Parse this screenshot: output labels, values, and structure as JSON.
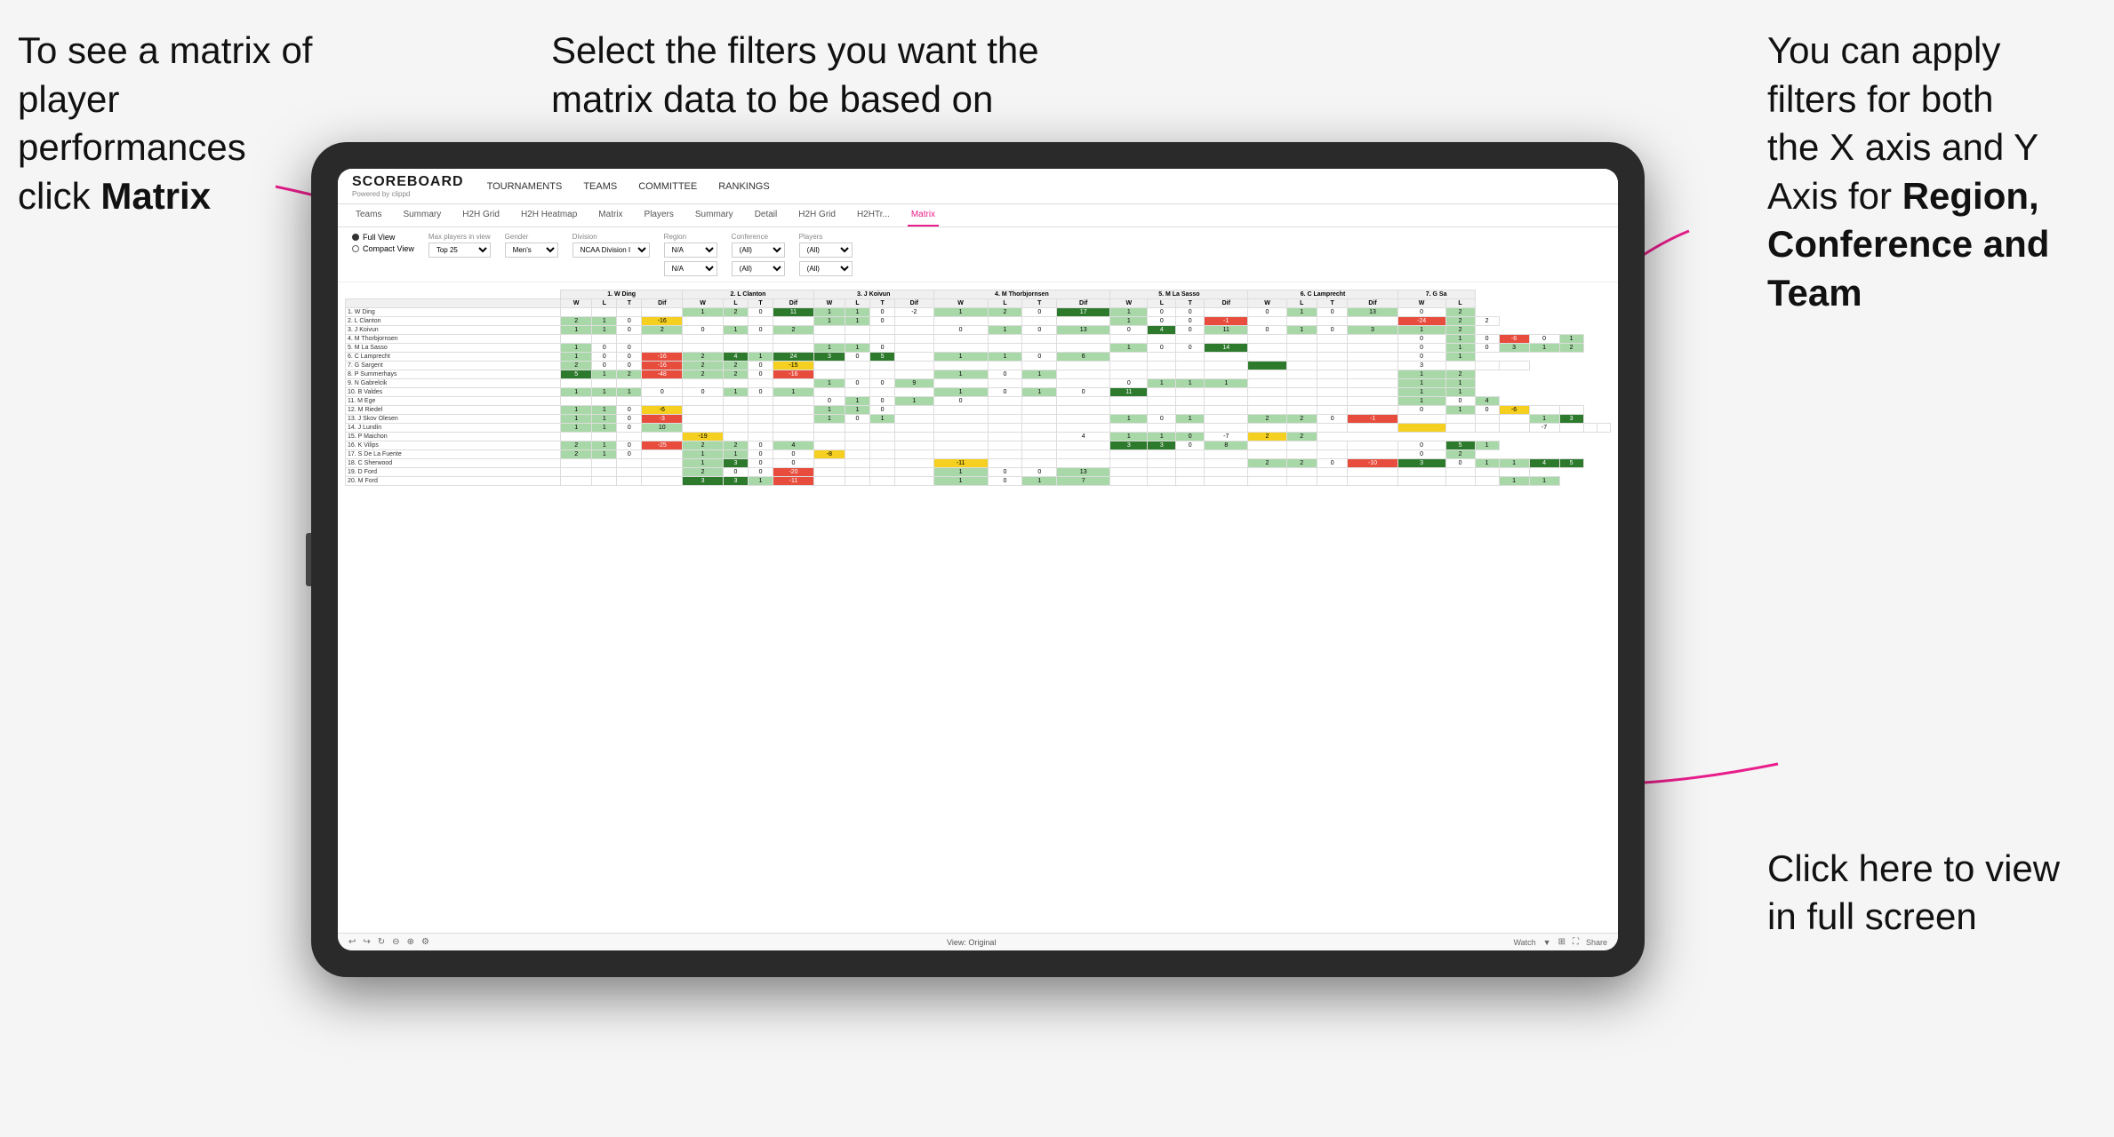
{
  "annotations": {
    "top_left": {
      "line1": "To see a matrix of",
      "line2": "player performances",
      "line3_normal": "click ",
      "line3_bold": "Matrix"
    },
    "top_center": {
      "line1": "Select the filters you want the",
      "line2": "matrix data to be based on"
    },
    "top_right": {
      "line1": "You  can apply",
      "line2": "filters for both",
      "line3": "the X axis and Y",
      "line4_normal": "Axis for ",
      "line4_bold": "Region,",
      "line5_bold": "Conference and",
      "line6_bold": "Team"
    },
    "bottom_right": {
      "line1": "Click here to view",
      "line2": "in full screen"
    }
  },
  "app": {
    "logo": "SCOREBOARD",
    "logo_sub": "Powered by clippd",
    "nav": [
      "TOURNAMENTS",
      "TEAMS",
      "COMMITTEE",
      "RANKINGS"
    ],
    "sub_nav": [
      "Teams",
      "Summary",
      "H2H Grid",
      "H2H Heatmap",
      "Matrix",
      "Players",
      "Summary",
      "Detail",
      "H2H Grid",
      "H2HTr...",
      "Matrix"
    ],
    "active_sub_nav": "Matrix"
  },
  "filters": {
    "view_full": "Full View",
    "view_compact": "Compact View",
    "max_players_label": "Max players in view",
    "max_players_value": "Top 25",
    "gender_label": "Gender",
    "gender_value": "Men's",
    "division_label": "Division",
    "division_value": "NCAA Division I",
    "region_label": "Region",
    "region_value": "N/A",
    "conference_label": "Conference",
    "conference_value": "(All)",
    "players_label": "Players",
    "players_value": "(All)"
  },
  "matrix": {
    "col_headers": [
      "1. W Ding",
      "2. L Clanton",
      "3. J Koivun",
      "4. M Thorbjornsen",
      "5. M La Sasso",
      "6. C Lamprecht",
      "7. G Sa"
    ],
    "sub_headers": [
      "W",
      "L",
      "T",
      "Dif"
    ],
    "rows": [
      {
        "name": "1. W Ding",
        "cells": [
          "",
          "",
          "",
          "",
          "1",
          "2",
          "0",
          "11",
          "1",
          "1",
          "0",
          "-2",
          "1",
          "2",
          "0",
          "17",
          "1",
          "0",
          "0",
          "",
          "0",
          "1",
          "0",
          "13",
          "0",
          "2"
        ]
      },
      {
        "name": "2. L Clanton",
        "cells": [
          "2",
          "1",
          "0",
          "-16",
          "",
          "",
          "",
          "",
          "1",
          "1",
          "0",
          "",
          "",
          "",
          "",
          "",
          "1",
          "0",
          "0",
          "-1",
          "",
          "",
          "",
          "",
          "-24",
          "2",
          "2"
        ]
      },
      {
        "name": "3. J Koivun",
        "cells": [
          "1",
          "1",
          "0",
          "2",
          "0",
          "1",
          "0",
          "2",
          "",
          "",
          "",
          "",
          "0",
          "1",
          "0",
          "13",
          "0",
          "4",
          "0",
          "11",
          "0",
          "1",
          "0",
          "3",
          "1",
          "2"
        ]
      },
      {
        "name": "4. M Thorbjornsen",
        "cells": [
          "",
          "",
          "",
          "",
          "",
          "",
          "",
          "",
          "",
          "",
          "",
          "",
          "",
          "",
          "",
          "",
          "",
          "",
          "",
          "",
          "",
          "",
          "",
          "",
          "0",
          "1",
          "0",
          "-6",
          "0",
          "1"
        ]
      },
      {
        "name": "5. M La Sasso",
        "cells": [
          "1",
          "0",
          "0",
          "",
          "",
          "",
          "",
          "",
          "1",
          "1",
          "0",
          "",
          "",
          "",
          "",
          "",
          "1",
          "0",
          "0",
          "14",
          "",
          "",
          "",
          "",
          "0",
          "1",
          "0",
          "3",
          "1",
          "2"
        ]
      },
      {
        "name": "6. C Lamprecht",
        "cells": [
          "1",
          "0",
          "0",
          "-16",
          "2",
          "4",
          "1",
          "24",
          "3",
          "0",
          "5",
          "",
          "1",
          "1",
          "0",
          "6",
          "",
          "",
          "",
          "",
          "",
          "",
          "",
          "",
          "0",
          "1"
        ]
      },
      {
        "name": "7. G Sargent",
        "cells": [
          "2",
          "0",
          "0",
          "-16",
          "2",
          "2",
          "0",
          "-15",
          "",
          "",
          "",
          "",
          "",
          "",
          "",
          "",
          "",
          "",
          "",
          "",
          "",
          "",
          "",
          "",
          "3",
          "",
          "",
          ""
        ]
      },
      {
        "name": "8. P Summerhays",
        "cells": [
          "5",
          "1",
          "2",
          "-48",
          "2",
          "2",
          "0",
          "-16",
          "",
          "",
          "",
          "",
          "1",
          "0",
          "1",
          "",
          "",
          "",
          "",
          "",
          "",
          "",
          "",
          "",
          "1",
          "2"
        ]
      },
      {
        "name": "9. N Gabrelcik",
        "cells": [
          "",
          "",
          "",
          "",
          "",
          "",
          "",
          "",
          "1",
          "0",
          "0",
          "9",
          "",
          "",
          "",
          "",
          "0",
          "1",
          "1",
          "1",
          "",
          "",
          "",
          "",
          "1",
          "1"
        ]
      },
      {
        "name": "10. B Valdes",
        "cells": [
          "1",
          "1",
          "1",
          "0",
          "0",
          "1",
          "0",
          "1",
          "",
          "",
          "",
          "",
          "1",
          "0",
          "1",
          "0",
          "11",
          "",
          "",
          "",
          "",
          "",
          "",
          "",
          "1",
          "1"
        ]
      },
      {
        "name": "11. M Ege",
        "cells": [
          "",
          "",
          "",
          "",
          "",
          "",
          "",
          "",
          "0",
          "1",
          "0",
          "1",
          "0",
          "",
          "",
          "",
          "",
          "",
          "",
          "",
          "",
          "",
          "",
          "",
          "1",
          "0",
          "4"
        ]
      },
      {
        "name": "12. M Riedel",
        "cells": [
          "1",
          "1",
          "0",
          "-6",
          "",
          "",
          "",
          "",
          "1",
          "1",
          "0",
          "",
          "",
          "",
          "",
          "",
          "",
          "",
          "",
          "",
          "",
          "",
          "",
          "",
          "0",
          "1",
          "0",
          "-6",
          "",
          ""
        ]
      },
      {
        "name": "13. J Skov Olesen",
        "cells": [
          "1",
          "1",
          "0",
          "-3",
          "",
          "",
          "",
          "",
          "1",
          "0",
          "1",
          "",
          "",
          "",
          "",
          "",
          "1",
          "0",
          "1",
          "",
          "2",
          "2",
          "0",
          "-1",
          "",
          "",
          "",
          "",
          "1",
          "3"
        ]
      },
      {
        "name": "14. J Lundin",
        "cells": [
          "1",
          "1",
          "0",
          "10",
          "",
          "",
          "",
          "",
          "",
          "",
          "",
          "",
          "",
          "",
          "",
          "",
          "",
          "",
          "",
          "",
          "",
          "",
          "",
          "",
          "",
          "",
          "",
          "",
          "-7",
          "",
          "",
          ""
        ]
      },
      {
        "name": "15. P Maichon",
        "cells": [
          "",
          "",
          "",
          "",
          "-19",
          "",
          "",
          "",
          "",
          "",
          "",
          "",
          "",
          "",
          "",
          "4",
          "1",
          "1",
          "0",
          "-7",
          "2",
          "2"
        ]
      },
      {
        "name": "16. K Vilips",
        "cells": [
          "2",
          "1",
          "0",
          "-25",
          "2",
          "2",
          "0",
          "4",
          "",
          "",
          "",
          "",
          "",
          "",
          "",
          "",
          "3",
          "3",
          "0",
          "8",
          "",
          "",
          "",
          "",
          "0",
          "5",
          "1"
        ]
      },
      {
        "name": "17. S De La Fuente",
        "cells": [
          "2",
          "1",
          "0",
          "",
          "1",
          "1",
          "0",
          "0",
          "-8",
          "",
          "",
          "",
          "",
          "",
          "",
          "",
          "",
          "",
          "",
          "",
          "",
          "",
          "",
          "",
          "0",
          "2"
        ]
      },
      {
        "name": "18. C Sherwood",
        "cells": [
          "",
          "",
          "",
          "",
          "1",
          "3",
          "0",
          "0",
          "",
          "",
          "",
          "",
          "-11",
          "",
          "",
          "",
          "",
          "",
          "",
          "",
          "2",
          "2",
          "0",
          "-10",
          "3",
          "0",
          "1",
          "1",
          "4",
          "5"
        ]
      },
      {
        "name": "19. D Ford",
        "cells": [
          "",
          "",
          "",
          "",
          "2",
          "0",
          "0",
          "-20",
          "",
          "",
          "",
          "",
          "1",
          "0",
          "0",
          "13",
          "",
          "",
          "",
          "",
          "",
          "",
          "",
          "",
          "",
          "",
          "",
          ""
        ]
      },
      {
        "name": "20. M Ford",
        "cells": [
          "",
          "",
          "",
          "",
          "3",
          "3",
          "1",
          "-11",
          "",
          "",
          "",
          "",
          "1",
          "0",
          "1",
          "7",
          "",
          "",
          "",
          "",
          "",
          "",
          "",
          "",
          "",
          "",
          "",
          "1",
          "1"
        ]
      }
    ]
  },
  "toolbar": {
    "view_label": "View: Original",
    "watch_label": "Watch",
    "share_label": "Share"
  }
}
